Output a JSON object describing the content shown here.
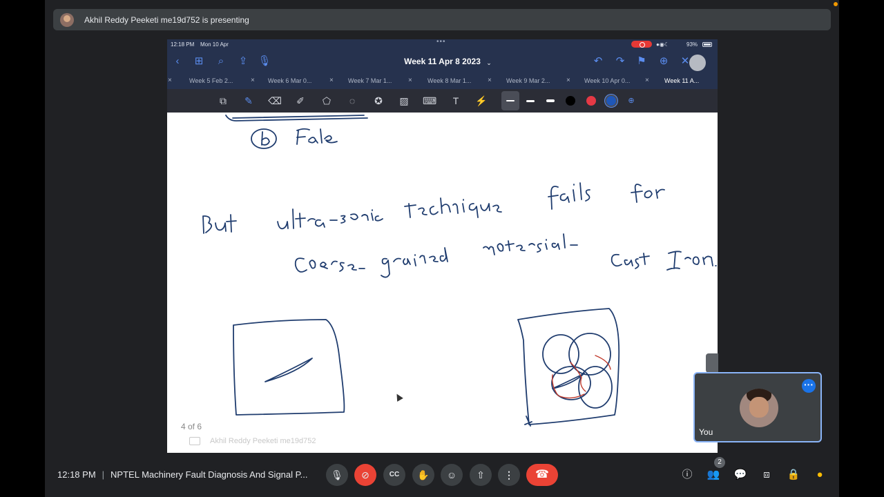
{
  "banner": {
    "text": "Akhil Reddy Peeketi me19d752 is presenting"
  },
  "ipad": {
    "status_time": "12:18 PM",
    "status_date": "Mon 10 Apr",
    "battery": "93%",
    "document_title": "Week 11 Apr 8 2023",
    "tabs": [
      "Week 5 Feb 2...",
      "Week 6 Mar 0...",
      "Week 7 Mar 1...",
      "Week 8 Mar 1...",
      "Week 9 Mar 2...",
      "Week 10 Apr 0...",
      "Week 11 A..."
    ],
    "pen_colors": [
      "#000000",
      "#e53945",
      "#1f57b8"
    ],
    "page_indicator": "4 of 6",
    "watermark": "Akhil Reddy Peeketi me19d752"
  },
  "notes": {
    "line1": "b  False",
    "line2": "But ultra-sonic technique fails for",
    "line3": "Coarse-grained materials - Cast Iron."
  },
  "self_view": {
    "name": "You"
  },
  "meeting": {
    "time": "12:18 PM",
    "title": "NPTEL Machinery Fault Diagnosis And Signal P...",
    "participant_count": "2"
  }
}
